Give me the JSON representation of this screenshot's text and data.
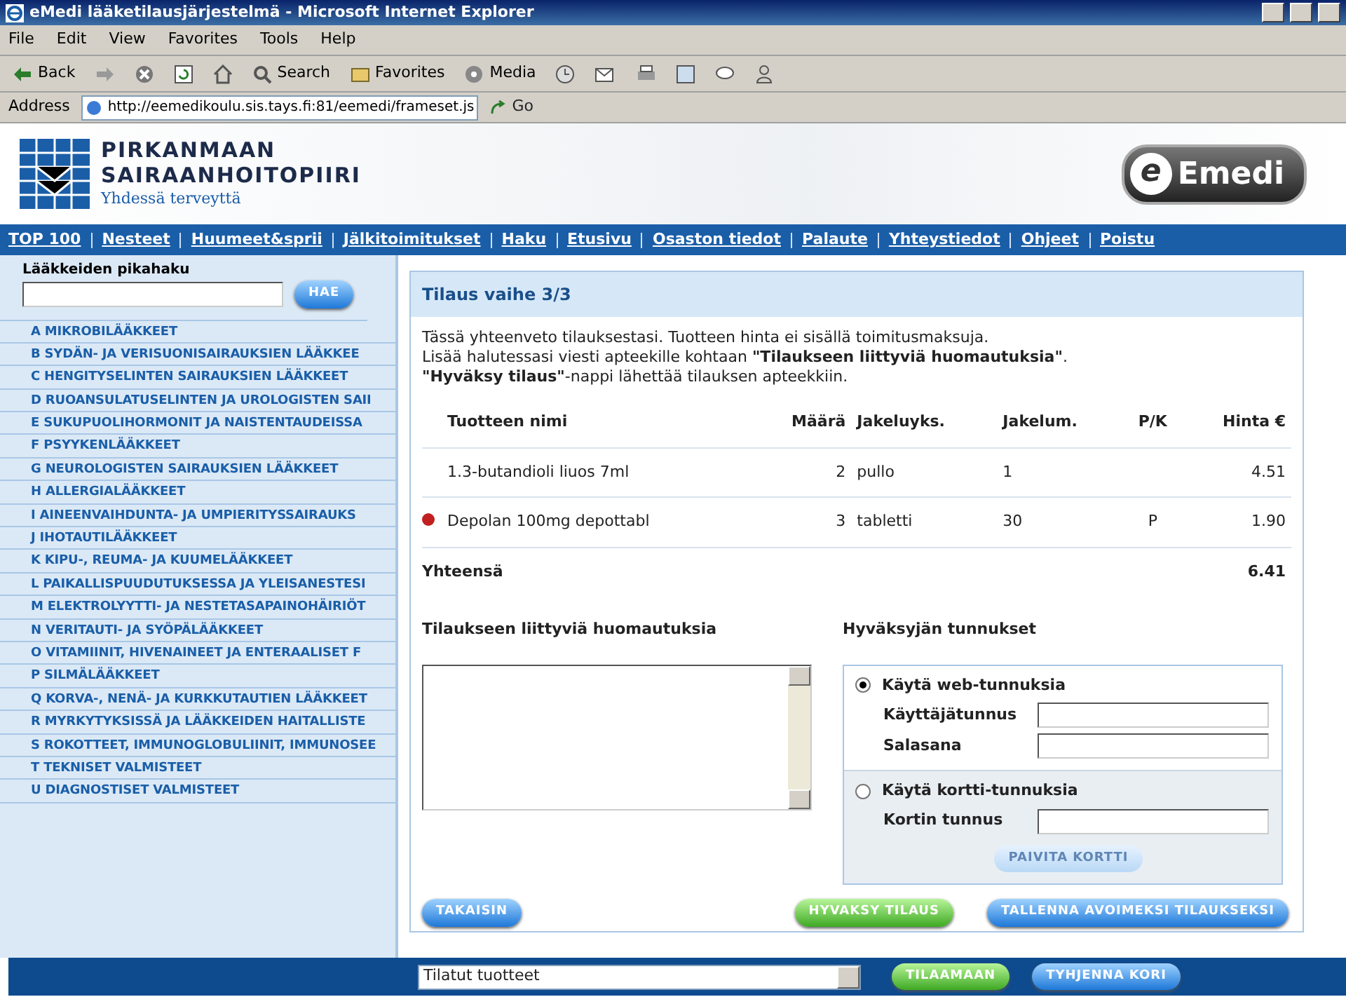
{
  "window": {
    "title": "eMedi lääketilausjärjestelmä - Microsoft Internet Explorer"
  },
  "menu": [
    "File",
    "Edit",
    "View",
    "Favorites",
    "Tools",
    "Help"
  ],
  "toolbar": {
    "back": "Back",
    "search": "Search",
    "favorites": "Favorites",
    "media": "Media"
  },
  "address": {
    "label": "Address",
    "url": "http://eemedikoulu.sis.tays.fi:81/eemedi/frameset.js",
    "go": "Go"
  },
  "header": {
    "org_line1": "PIRKANMAAN",
    "org_line2": "SAIRAANHOITOPIIRI",
    "slogan": "Yhdessä terveyttä",
    "brand_mark": "e",
    "brand": "Emedi"
  },
  "nav": [
    "TOP 100",
    "Nesteet",
    "Huumeet&sprii",
    "Jälkitoimitukset",
    "Haku",
    "Etusivu",
    "Osaston tiedot",
    "Palaute",
    "Yhteystiedot",
    "Ohjeet",
    "Poistu"
  ],
  "sidebar": {
    "search_label": "Lääkkeiden pikahaku",
    "search_button": "HAE",
    "categories": [
      "A MIKROBILÄÄKKEET",
      "B SYDÄN- JA VERISUONISAIRAUKSIEN LÄÄKKEE",
      "C HENGITYSELINTEN SAIRAUKSIEN LÄÄKKEET",
      "D RUOANSULATUSELINTEN JA UROLOGISTEN SAII",
      "E SUKUPUOLIHORMONIT JA NAISTENTAUDEISSA",
      "F PSYYKENLÄÄKKEET",
      "G NEUROLOGISTEN SAIRAUKSIEN LÄÄKKEET",
      "H ALLERGIALÄÄKKEET",
      "I AINEENVAIHDUNTA- JA UMPIERITYSSAIRAUKS",
      "J IHOTAUTILÄÄKKEET",
      "K KIPU-, REUMA- JA KUUMELÄÄKKEET",
      "L PAIKALLISPUUDUTUKSESSA JA YLEISANESTESI",
      "M ELEKTROLYYTTI- JA NESTETASAPAINOHÄIRIÖT",
      "N VERITAUTI- JA SYÖPÄLÄÄKKEET",
      "O VITAMIINIT, HIVENAINEET JA ENTERAALISET F",
      "P SILMÄLÄÄKKEET",
      "Q KORVA-, NENÄ- JA KURKKUTAUTIEN LÄÄKKEET",
      "R MYRKYTYKSISSÄ JA LÄÄKKEIDEN HAITALLISTE",
      "S ROKOTTEET, IMMUNOGLOBULIINIT, IMMUNOSEE",
      "T TEKNISET VALMISTEET",
      "U DIAGNOSTISET VALMISTEET"
    ]
  },
  "order": {
    "title": "Tilaus vaihe 3/3",
    "intro": [
      "Tässä yhteenveto tilauksestasi. Tuotteen hinta ei sisällä toimitusmaksuja.",
      "Lisää halutessasi viesti apteekille kohtaan **\"Tilaukseen liittyviä huomautuksia\"**.",
      "**\"Hyväksy tilaus\"**-nappi lähettää tilauksen apteekkiin."
    ],
    "columns": [
      "Tuotteen nimi",
      "Määrä",
      "Jakeluyks.",
      "Jakelum.",
      "P/K",
      "Hinta €"
    ],
    "rows": [
      {
        "marked": false,
        "cells": [
          "1.3-butandioli liuos 7ml",
          "2",
          "pullo",
          "1",
          "",
          "4.51"
        ]
      },
      {
        "marked": true,
        "cells": [
          "Depolan 100mg depottabl",
          "3",
          "tabletti",
          "30",
          "P",
          "1.90"
        ]
      }
    ],
    "total_label": "Yhteensä",
    "total": "6.41"
  },
  "notes": {
    "label": "Tilaukseen liittyviä huomautuksia"
  },
  "approver": {
    "label": "Hyväksyjän tunnukset",
    "options": [
      {
        "label": "Käytä web-tunnuksia",
        "selected": true,
        "fields": [
          "Käyttäjätunnus",
          "Salasana"
        ]
      },
      {
        "label": "Käytä kortti-tunnuksia",
        "selected": false,
        "fields": [
          "Kortin tunnus"
        ],
        "button": {
          "label": "PAIVITA KORTTI",
          "disabled": true
        }
      }
    ]
  },
  "actions": {
    "back": "TAKAISIN",
    "approve": "HYVAKSY TILAUS",
    "save": "TALLENNA AVOIMEKSI TILAUKSEKSI"
  },
  "bottom": {
    "select_value": "Tilatut tuotteet",
    "order_button": "TILAAMAAN",
    "clear_button": "TYHJENNA KORI"
  }
}
